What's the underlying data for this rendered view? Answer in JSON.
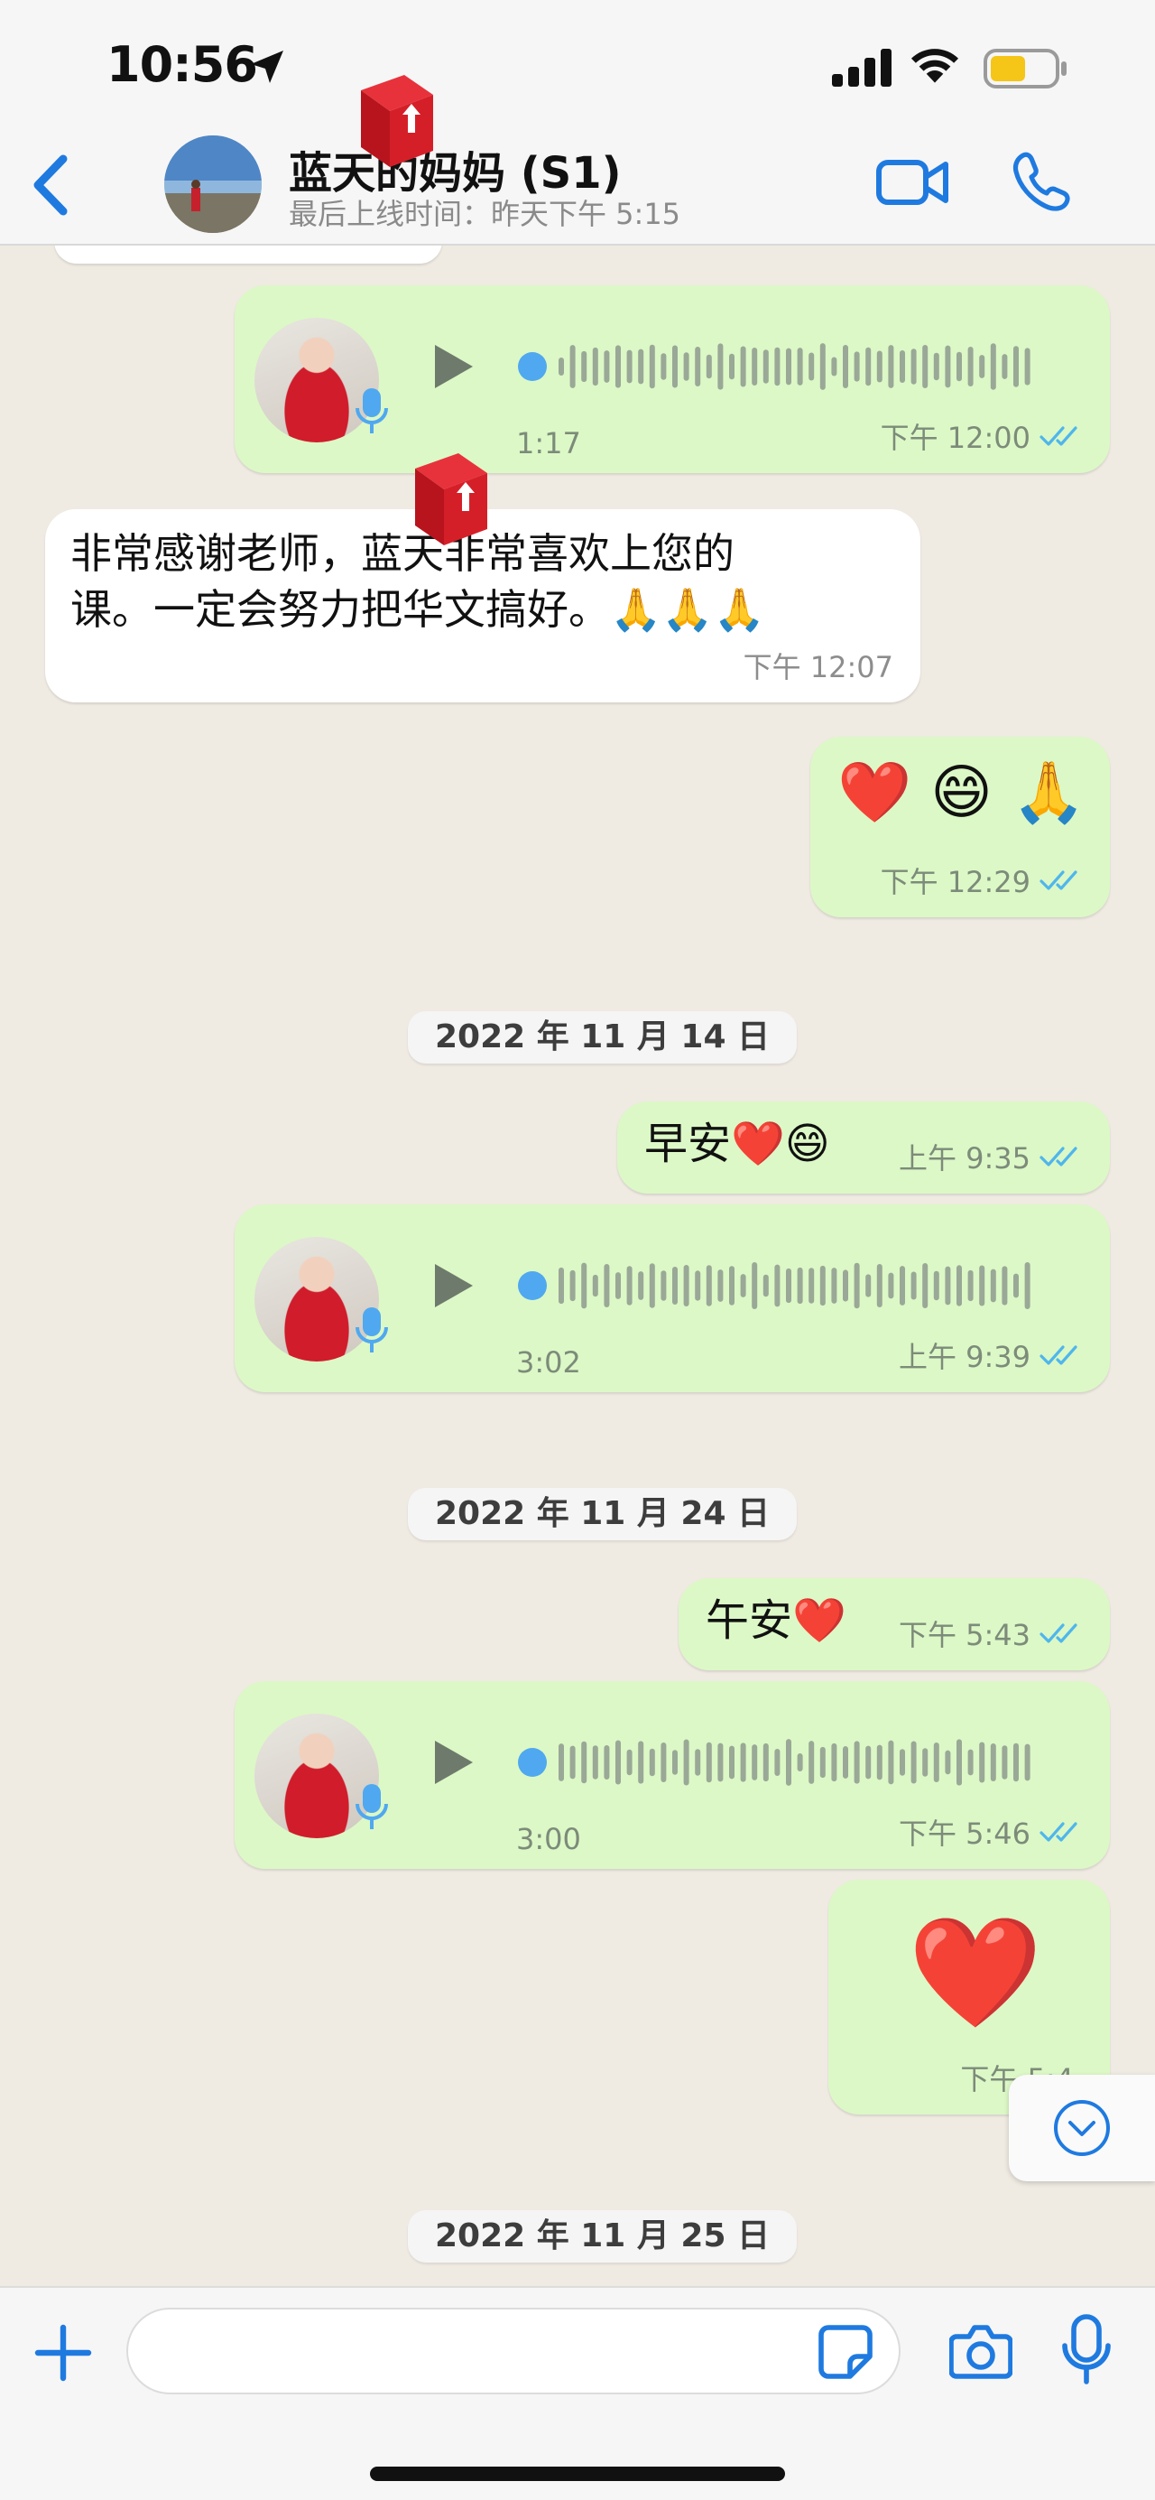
{
  "status_bar": {
    "time": "10:56"
  },
  "header": {
    "contact_name": "蓝天的妈妈 (S1)",
    "last_seen": "最后上线时间：昨天下午 5:15",
    "accent": "#1f7ae0"
  },
  "messages": [
    {
      "kind": "voice",
      "direction": "out",
      "duration": "1:17",
      "time": "下午 12:00"
    },
    {
      "kind": "text",
      "direction": "in",
      "text": "非常感谢老师，蓝天非常喜欢上您的\n课。一定会努力把华文搞好。🙏🙏🙏",
      "time": "下午 12:07"
    },
    {
      "kind": "emoji",
      "direction": "out",
      "text": "❤️ 😄 🙏",
      "time": "下午 12:29"
    },
    {
      "kind": "date",
      "text": "2022 年 11 月 14 日"
    },
    {
      "kind": "text",
      "direction": "out",
      "text": "早安❤️😄",
      "time": "上午 9:35"
    },
    {
      "kind": "voice",
      "direction": "out",
      "duration": "3:02",
      "time": "上午 9:39"
    },
    {
      "kind": "date",
      "text": "2022 年 11 月 24 日"
    },
    {
      "kind": "text",
      "direction": "out",
      "text": "午安❤️",
      "time": "下午 5:43"
    },
    {
      "kind": "voice",
      "direction": "out",
      "duration": "3:00",
      "time": "下午 5:46"
    },
    {
      "kind": "emoji",
      "direction": "out",
      "text": "❤️",
      "time": "下午 5:4"
    },
    {
      "kind": "date",
      "text": "2022 年 11 月 25 日"
    }
  ],
  "composer": {
    "placeholder": ""
  },
  "icons": {
    "back": "chevron-left-icon",
    "video": "video-camera-icon",
    "phone": "phone-icon",
    "plus": "plus-icon",
    "sticker": "sticker-icon",
    "camera": "camera-icon",
    "mic": "microphone-icon",
    "scroll": "chevron-down-circle-icon"
  },
  "colors": {
    "outgoing_bubble": "#dcf8c6",
    "incoming_bubble": "#ffffff",
    "chat_background": "#efeae2",
    "read_ticks": "#4fb6ec",
    "voice_dot": "#4fa8f0"
  }
}
